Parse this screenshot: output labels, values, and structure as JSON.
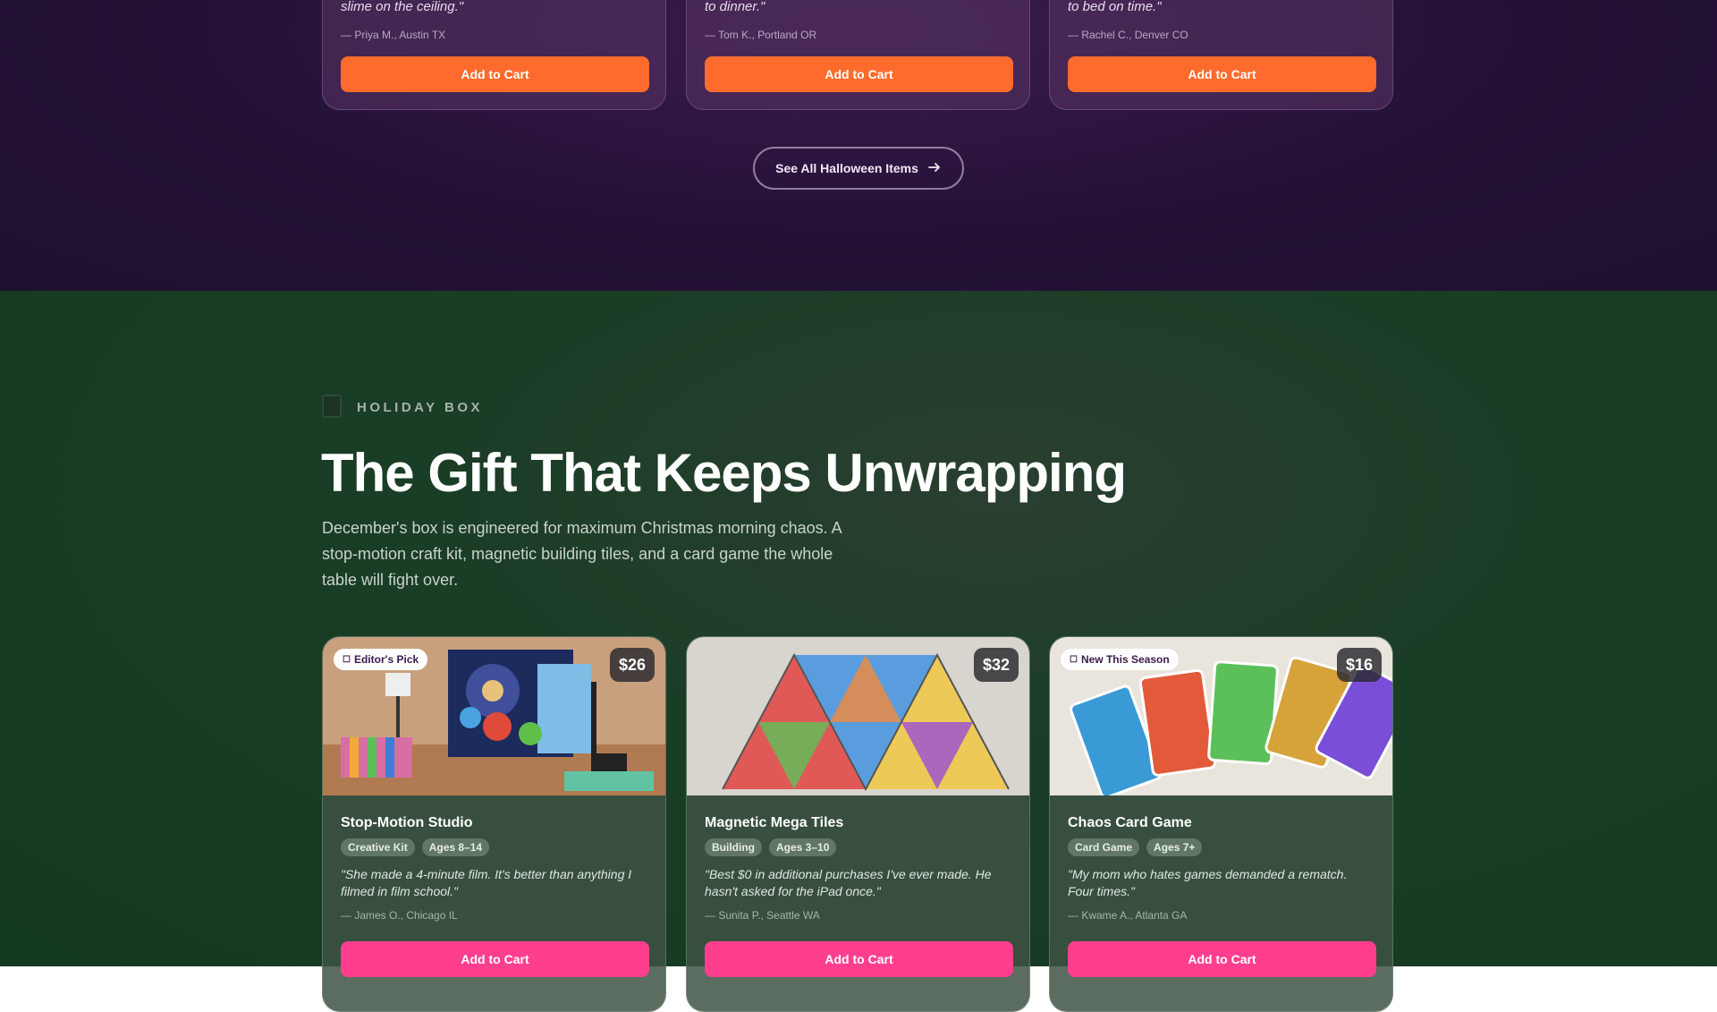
{
  "halloween": {
    "cards": [
      {
        "quote_tail": "slime on the ceiling.\"",
        "author": "— Priya M., Austin TX",
        "cta": "Add to Cart"
      },
      {
        "quote_tail": "to dinner.\"",
        "author": "— Tom K., Portland OR",
        "cta": "Add to Cart"
      },
      {
        "quote_tail": "to bed on time.\"",
        "author": "— Rachel C., Denver CO",
        "cta": "Add to Cart"
      }
    ],
    "see_all_label": "See All Halloween Items"
  },
  "holiday": {
    "eyebrow": "HOLIDAY BOX",
    "headline": "The Gift That Keeps Unwrapping",
    "description": "December's box is engineered for maximum Christmas morning chaos. A stop-motion craft kit, magnetic building tiles, and a card game the whole table will fight over.",
    "products": [
      {
        "badge": "Editor's Pick",
        "price": "$26",
        "name": "Stop-Motion Studio",
        "tags": [
          "Creative Kit",
          "Ages 8–14"
        ],
        "review": "\"She made a 4-minute film. It's better than anything I filmed in film school.\"",
        "author": "— James O., Chicago IL",
        "cta": "Add to Cart"
      },
      {
        "badge": "",
        "price": "$32",
        "name": "Magnetic Mega Tiles",
        "tags": [
          "Building",
          "Ages 3–10"
        ],
        "review": "\"Best $0 in additional purchases I've ever made. He hasn't asked for the iPad once.\"",
        "author": "— Sunita P., Seattle WA",
        "cta": "Add to Cart"
      },
      {
        "badge": "New This Season",
        "price": "$16",
        "name": "Chaos Card Game",
        "tags": [
          "Card Game",
          "Ages 7+"
        ],
        "review": "\"My mom who hates games demanded a rematch. Four times.\"",
        "author": "— Kwame A., Atlanta GA",
        "cta": "Add to Cart"
      }
    ]
  },
  "colors": {
    "orange_cta": "#ff6b2c",
    "pink_cta": "#ff3f8e",
    "halloween_bg": "#241236",
    "holiday_bg": "#1a3d26"
  },
  "icons": {
    "see_all": "arrow-right-icon",
    "eyebrow": "gift-box-icon",
    "badge": "star-icon"
  }
}
